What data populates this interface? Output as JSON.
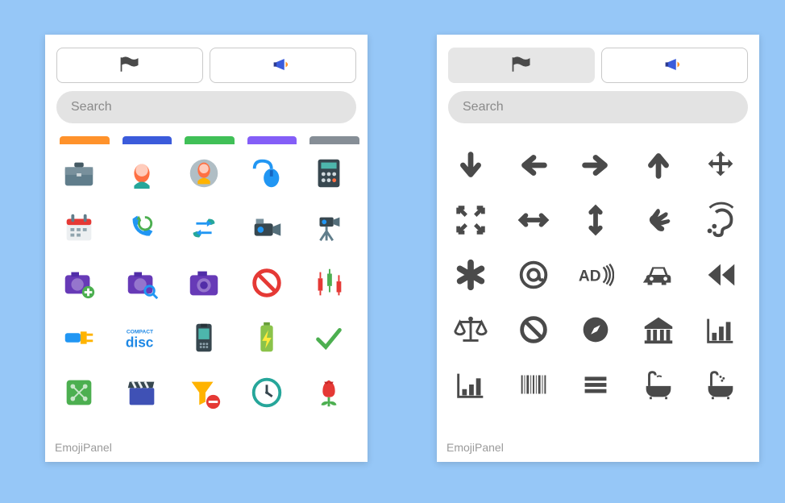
{
  "footer_label": "EmojiPanel",
  "search_placeholder": "Search",
  "tabs": [
    {
      "id": "flags",
      "icon": "flag-icon"
    },
    {
      "id": "announce",
      "icon": "megaphone-icon"
    }
  ],
  "left_panel": {
    "active_tab": 0,
    "icons": [
      [
        "briefcase",
        "woman",
        "woman-circle",
        "mouse-cable",
        "calculator"
      ],
      [
        "calendar",
        "phone-refresh",
        "phone-transfer",
        "camcorder",
        "camcorder-tripod"
      ],
      [
        "camera-plus",
        "camera-search",
        "camera",
        "cancel",
        "candlestick"
      ],
      [
        "plug",
        "compact-disc",
        "phone-handset",
        "battery-charging",
        "checkmark"
      ],
      [
        "circuit",
        "clapperboard",
        "funnel-minus",
        "clock",
        "tulip"
      ]
    ]
  },
  "right_panel": {
    "active_tab": 1,
    "icons": [
      [
        "arrow-down",
        "arrow-left",
        "arrow-right",
        "arrow-up",
        "arrows-move"
      ],
      [
        "arrows-expand",
        "arrows-h",
        "arrows-v",
        "sign-language",
        "assistive-listening"
      ],
      [
        "asterisk",
        "at-sign",
        "audio-description",
        "car",
        "fast-backward"
      ],
      [
        "balance-scale",
        "ban",
        "compass",
        "bank",
        "bar-chart"
      ],
      [
        "bar-chart-inc",
        "barcode",
        "bars-menu",
        "bath",
        "bath-alt"
      ]
    ]
  }
}
